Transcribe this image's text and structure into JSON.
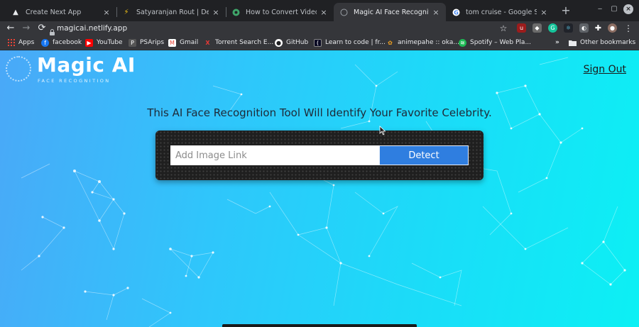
{
  "browser": {
    "tabs": [
      {
        "title": "Create Next App",
        "favicon": "nextjs-icon",
        "active": false
      },
      {
        "title": "Satyaranjan Rout | Developer",
        "favicon": "bolt-icon",
        "active": false
      },
      {
        "title": "How to Convert Video to GIF",
        "favicon": "convert-icon",
        "active": false
      },
      {
        "title": "Magic AI Face Recognition",
        "favicon": "page-icon",
        "active": true
      },
      {
        "title": "tom cruise - Google Search",
        "favicon": "google-icon",
        "active": false
      }
    ],
    "new_tab": "+",
    "window_controls": {
      "minimize": "‒",
      "maximize": "▢",
      "close": "×"
    },
    "url": "magicai.netlify.app",
    "bookmarks": [
      {
        "label": "Apps",
        "icon": "apps-grid-icon",
        "color": "#ea4335"
      },
      {
        "label": "facebook",
        "icon": "facebook-icon",
        "color": "#1877f2"
      },
      {
        "label": "YouTube",
        "icon": "youtube-icon",
        "color": "#ff0000"
      },
      {
        "label": "PSArips",
        "icon": "psarips-icon",
        "color": "#555555"
      },
      {
        "label": "Gmail",
        "icon": "gmail-icon",
        "color": "#ea4335"
      },
      {
        "label": "Torrent Search E...",
        "icon": "torrent-icon",
        "color": "#e53935"
      },
      {
        "label": "GitHub",
        "icon": "github-icon",
        "color": "#ffffff"
      },
      {
        "label": "Learn to code | fr...",
        "icon": "freecodecamp-icon",
        "color": "#0a0a23"
      },
      {
        "label": "animepahe :: oka...",
        "icon": "animepahe-icon",
        "color": "#f0a020"
      },
      {
        "label": "Spotify – Web Pla...",
        "icon": "spotify-icon",
        "color": "#1db954"
      },
      {
        "label": "Other bookmarks",
        "icon": "folder-icon",
        "color": "#e8eaed"
      }
    ]
  },
  "app": {
    "logo_title": "Magic AI",
    "logo_subtitle": "FACE RECOGNITION",
    "sign_out": "Sign Out",
    "headline": "This AI Face Recognition Tool Will Identify Your Favorite Celebrity.",
    "input": {
      "placeholder": "Add Image Link",
      "value": ""
    },
    "detect_button": "Detect"
  },
  "colors": {
    "gradient_start": "#4aa8f8",
    "gradient_end": "#0cf0f4",
    "button": "#2f7ee0",
    "panel": "#1f1f1f"
  }
}
